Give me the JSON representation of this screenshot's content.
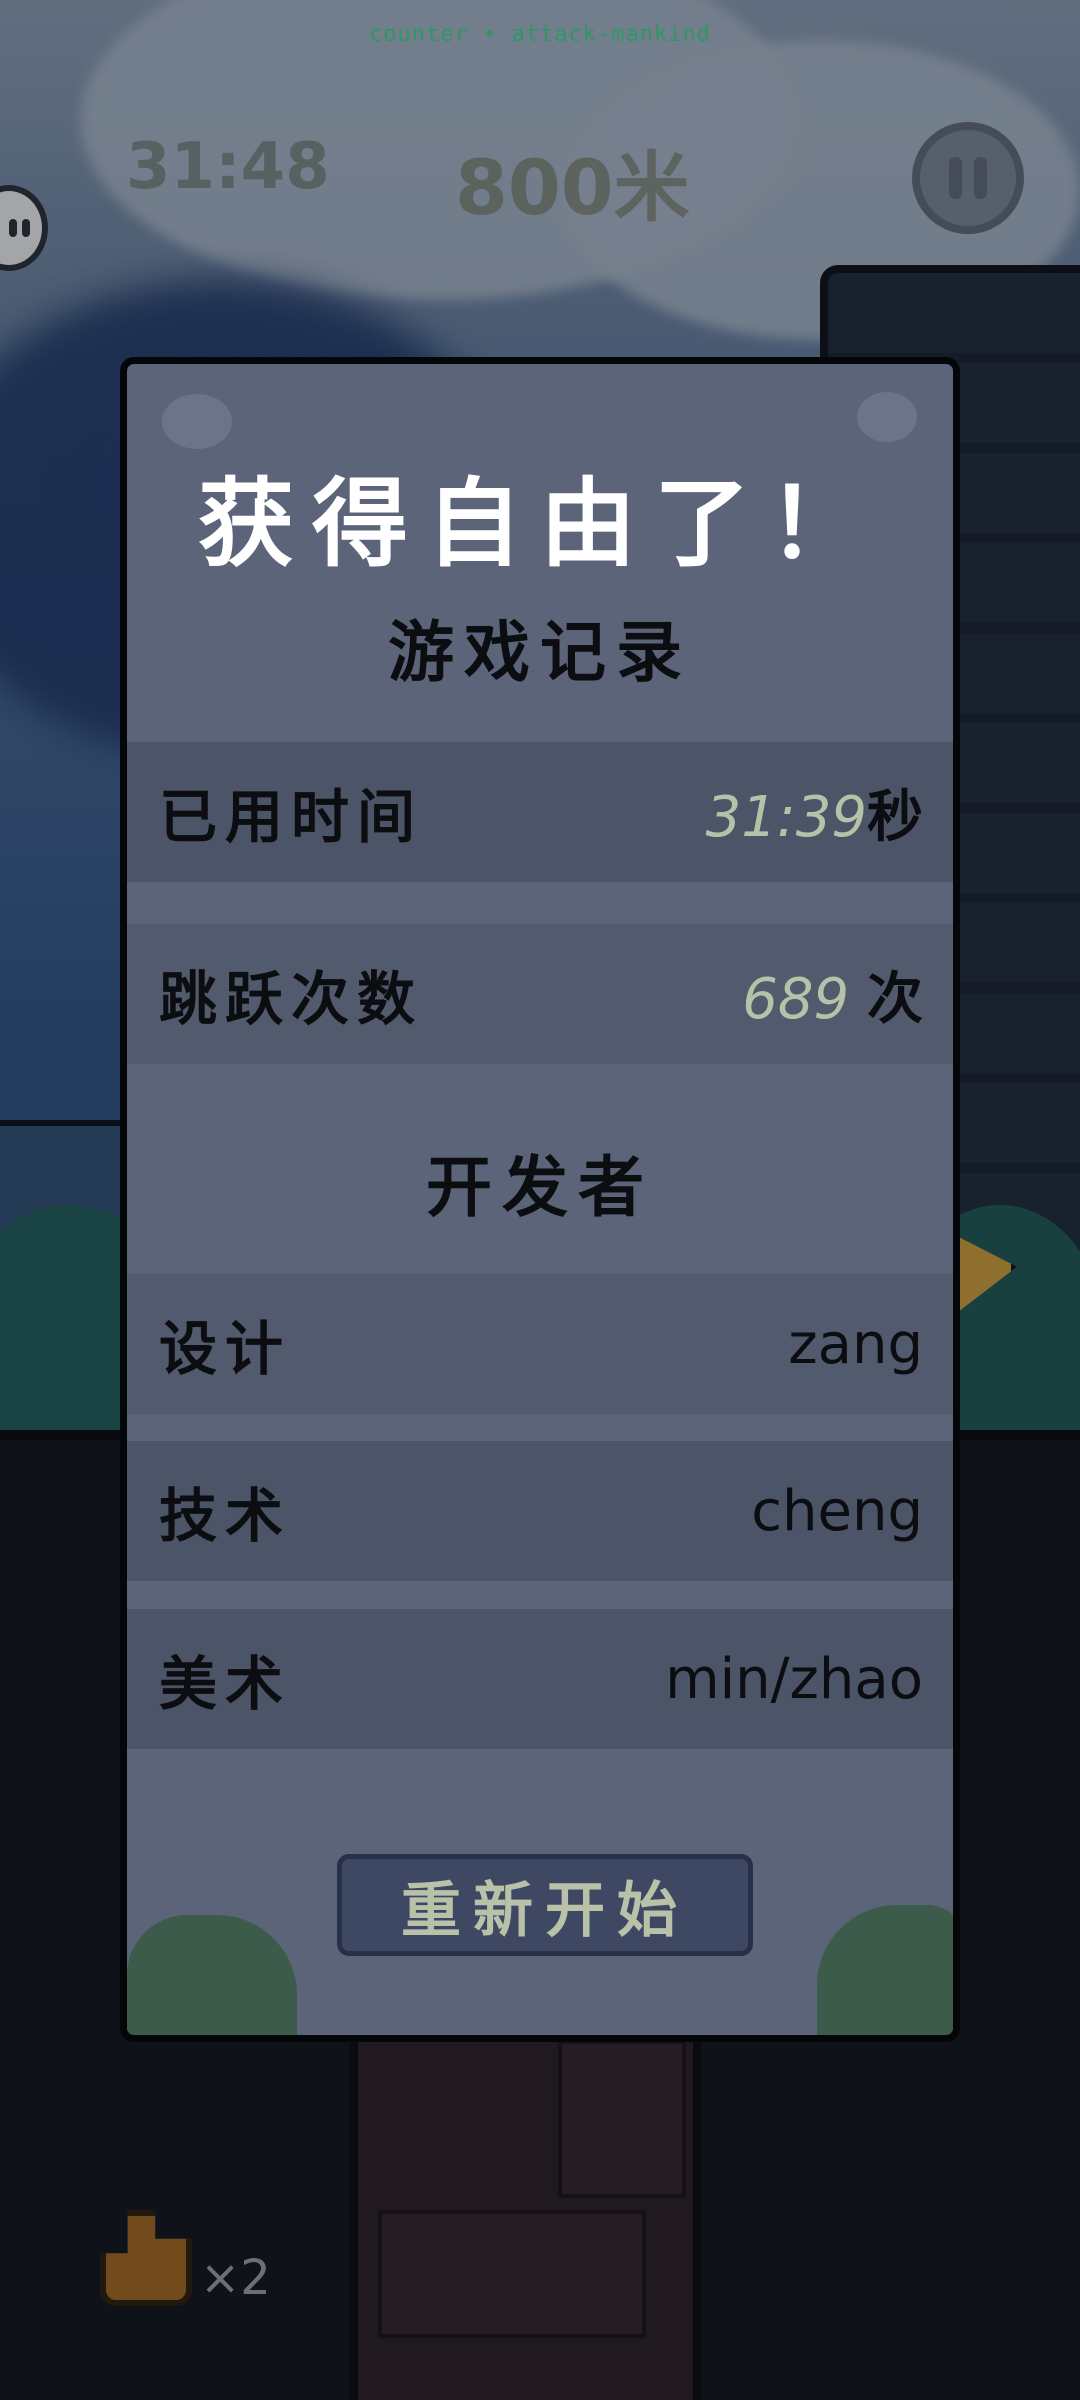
{
  "hud": {
    "top_text": "counter • attack-mankind",
    "time": "31:48",
    "distance": "800米",
    "lives": "×2"
  },
  "dialog": {
    "title": "获得自由了！",
    "record_heading": "游戏记录",
    "stats": [
      {
        "label": "已用时间",
        "value": "31:39",
        "unit": "秒"
      },
      {
        "label": "跳跃次数",
        "value": "689",
        "unit": "次"
      }
    ],
    "dev_heading": "开发者",
    "developers": [
      {
        "role": "设计",
        "name": "zang"
      },
      {
        "role": "技术",
        "name": "cheng"
      },
      {
        "role": "美术",
        "name": "min/zhao"
      }
    ],
    "restart_label": "重新开始"
  },
  "colors": {
    "panel": "#5b6479",
    "row_dark": "#4c5468",
    "number_accent": "#b6c2a7",
    "button": "#3f4862"
  }
}
